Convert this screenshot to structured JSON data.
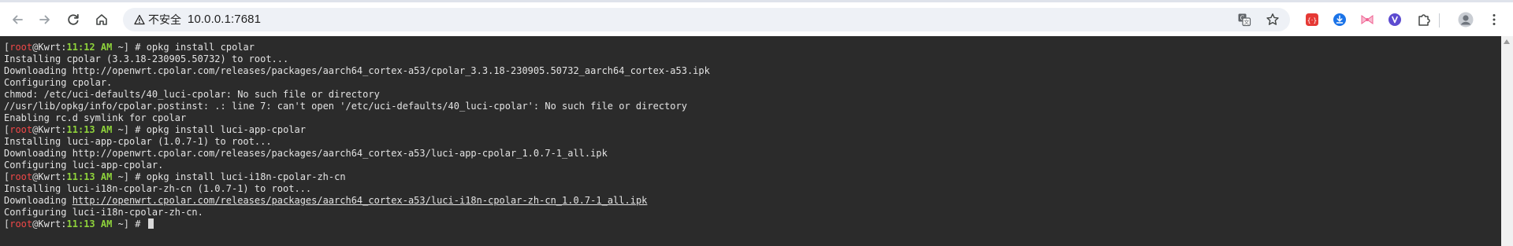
{
  "browser": {
    "security_label": "不安全",
    "url": "10.0.0.1:7681",
    "icons": {
      "back": "back-arrow-icon",
      "forward": "forward-arrow-icon",
      "reload": "reload-icon",
      "home": "home-icon",
      "warning": "warning-triangle-icon",
      "translate": "translate-icon",
      "bookmark": "star-icon",
      "extensions": "puzzle-icon",
      "profile": "avatar",
      "menu": "kebab-menu-icon"
    },
    "extensions": [
      {
        "name": "red-extension-icon",
        "color": "#e53935"
      },
      {
        "name": "blue-download-extension-icon",
        "color": "#1a73e8"
      },
      {
        "name": "pink-bow-extension-icon",
        "color": "#f48fb1"
      },
      {
        "name": "purple-extension-icon",
        "color": "#5c4bd0"
      }
    ]
  },
  "terminal": {
    "prompt": {
      "user": "root",
      "host": "Kwrt",
      "dir": "~",
      "symbol": "#"
    },
    "colors": {
      "background": "#2b2b2b",
      "text": "#e3e3e3",
      "user": "#f04848",
      "time": "#8ed23b"
    },
    "lines": [
      {
        "type": "prompt",
        "time": "11:12 AM",
        "command": "opkg install cpolar"
      },
      {
        "type": "output",
        "text": "Installing cpolar (3.3.18-230905.50732) to root..."
      },
      {
        "type": "output",
        "text": "Downloading http://openwrt.cpolar.com/releases/packages/aarch64_cortex-a53/cpolar_3.3.18-230905.50732_aarch64_cortex-a53.ipk"
      },
      {
        "type": "output",
        "text": "Configuring cpolar."
      },
      {
        "type": "output",
        "text": "chmod: /etc/uci-defaults/40_luci-cpolar: No such file or directory"
      },
      {
        "type": "output",
        "text": "//usr/lib/opkg/info/cpolar.postinst: .: line 7: can't open '/etc/uci-defaults/40_luci-cpolar': No such file or directory"
      },
      {
        "type": "output",
        "text": "Enabling rc.d symlink for cpolar"
      },
      {
        "type": "prompt",
        "time": "11:13 AM",
        "command": "opkg install luci-app-cpolar"
      },
      {
        "type": "output",
        "text": "Installing luci-app-cpolar (1.0.7-1) to root..."
      },
      {
        "type": "output",
        "text": "Downloading http://openwrt.cpolar.com/releases/packages/aarch64_cortex-a53/luci-app-cpolar_1.0.7-1_all.ipk"
      },
      {
        "type": "output",
        "text": "Configuring luci-app-cpolar."
      },
      {
        "type": "prompt",
        "time": "11:13 AM",
        "command": "opkg install luci-i18n-cpolar-zh-cn"
      },
      {
        "type": "output",
        "text": "Installing luci-i18n-cpolar-zh-cn (1.0.7-1) to root..."
      },
      {
        "type": "link_output",
        "prefix": "Downloading ",
        "link": "http://openwrt.cpolar.com/releases/packages/aarch64_cortex-a53/luci-i18n-cpolar-zh-cn_1.0.7-1_all.ipk"
      },
      {
        "type": "output",
        "text": "Configuring luci-i18n-cpolar-zh-cn."
      },
      {
        "type": "prompt",
        "time": "11:13 AM",
        "command": "",
        "cursor": true
      }
    ]
  }
}
